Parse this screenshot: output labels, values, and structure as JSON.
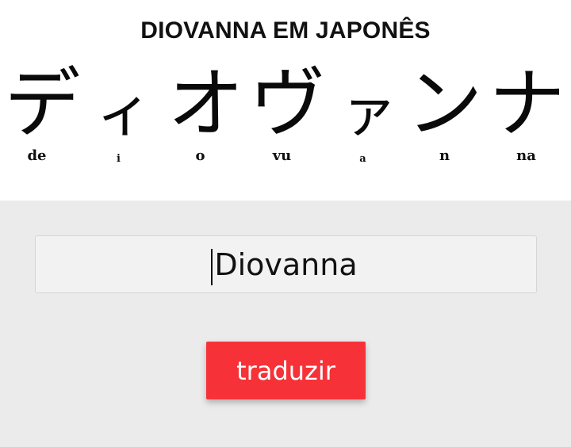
{
  "header": {
    "title": "DIOVANNA EM JAPONÊS"
  },
  "translation": {
    "kana": [
      "デ",
      "ィ",
      "オ",
      "ヴ",
      "ァ",
      "ン",
      "ナ"
    ],
    "romaji": [
      "de",
      "i",
      "o",
      "vu",
      "a",
      "n",
      "na"
    ]
  },
  "form": {
    "name_value": "Diovanna",
    "button_label": "traduzir"
  },
  "colors": {
    "button": "#f63238",
    "form_background": "#ebebeb",
    "input_background": "#f2f2f2"
  }
}
